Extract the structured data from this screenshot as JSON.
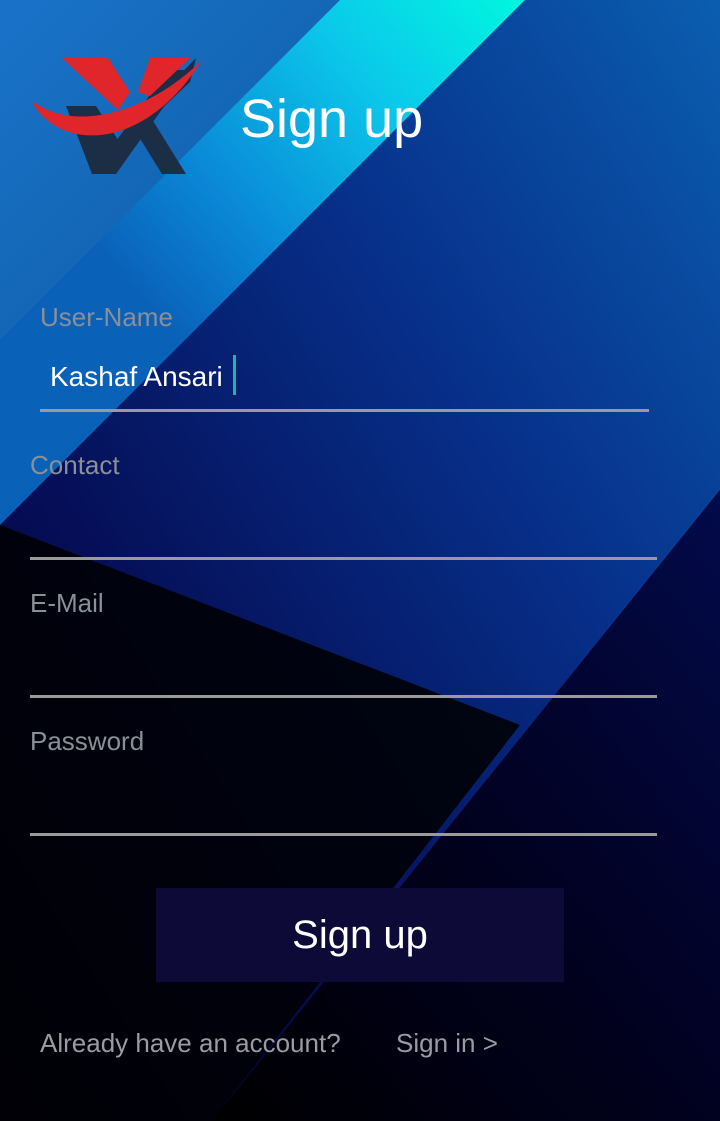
{
  "header": {
    "logo": "X",
    "title": "Sign up"
  },
  "form": {
    "username": {
      "label": "User-Name",
      "value": "Kashaf Ansari"
    },
    "contact": {
      "label": "Contact",
      "value": ""
    },
    "email": {
      "label": "E-Mail",
      "value": ""
    },
    "password": {
      "label": "Password",
      "value": ""
    }
  },
  "signup_button": {
    "label": "Sign up"
  },
  "footer": {
    "prompt": "Already have an account?",
    "signin_link": "Sign in >"
  },
  "colors": {
    "caret": "#1fb5a6",
    "button_bg": "#0e0a38",
    "logo_red": "#e0252b",
    "logo_navy": "#1b2e45"
  }
}
